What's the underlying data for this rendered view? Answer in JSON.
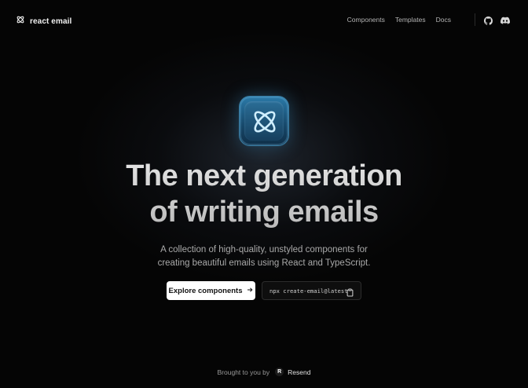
{
  "nav": {
    "brand": "react email",
    "links": [
      "Components",
      "Templates",
      "Docs"
    ],
    "github_icon": "github-icon",
    "discord_icon": "discord-icon"
  },
  "hero": {
    "logo_icon": "atom-icon",
    "title_line1": "The next generation",
    "title_line2": "of writing emails",
    "subtitle_line1": "A collection of high-quality, unstyled components for",
    "subtitle_line2": "creating beautiful emails using React and TypeScript.",
    "primary_button": "Explore components",
    "primary_button_icon": "arrow-right-icon",
    "command": "npx create-email@latest",
    "copy_icon": "clipboard-icon"
  },
  "footer": {
    "prefix": "Brought to you by",
    "badge": "R",
    "company": "Resend"
  },
  "colors": {
    "background": "#050505",
    "accent": "#2b7aa8",
    "button_bg": "#ffffff"
  }
}
